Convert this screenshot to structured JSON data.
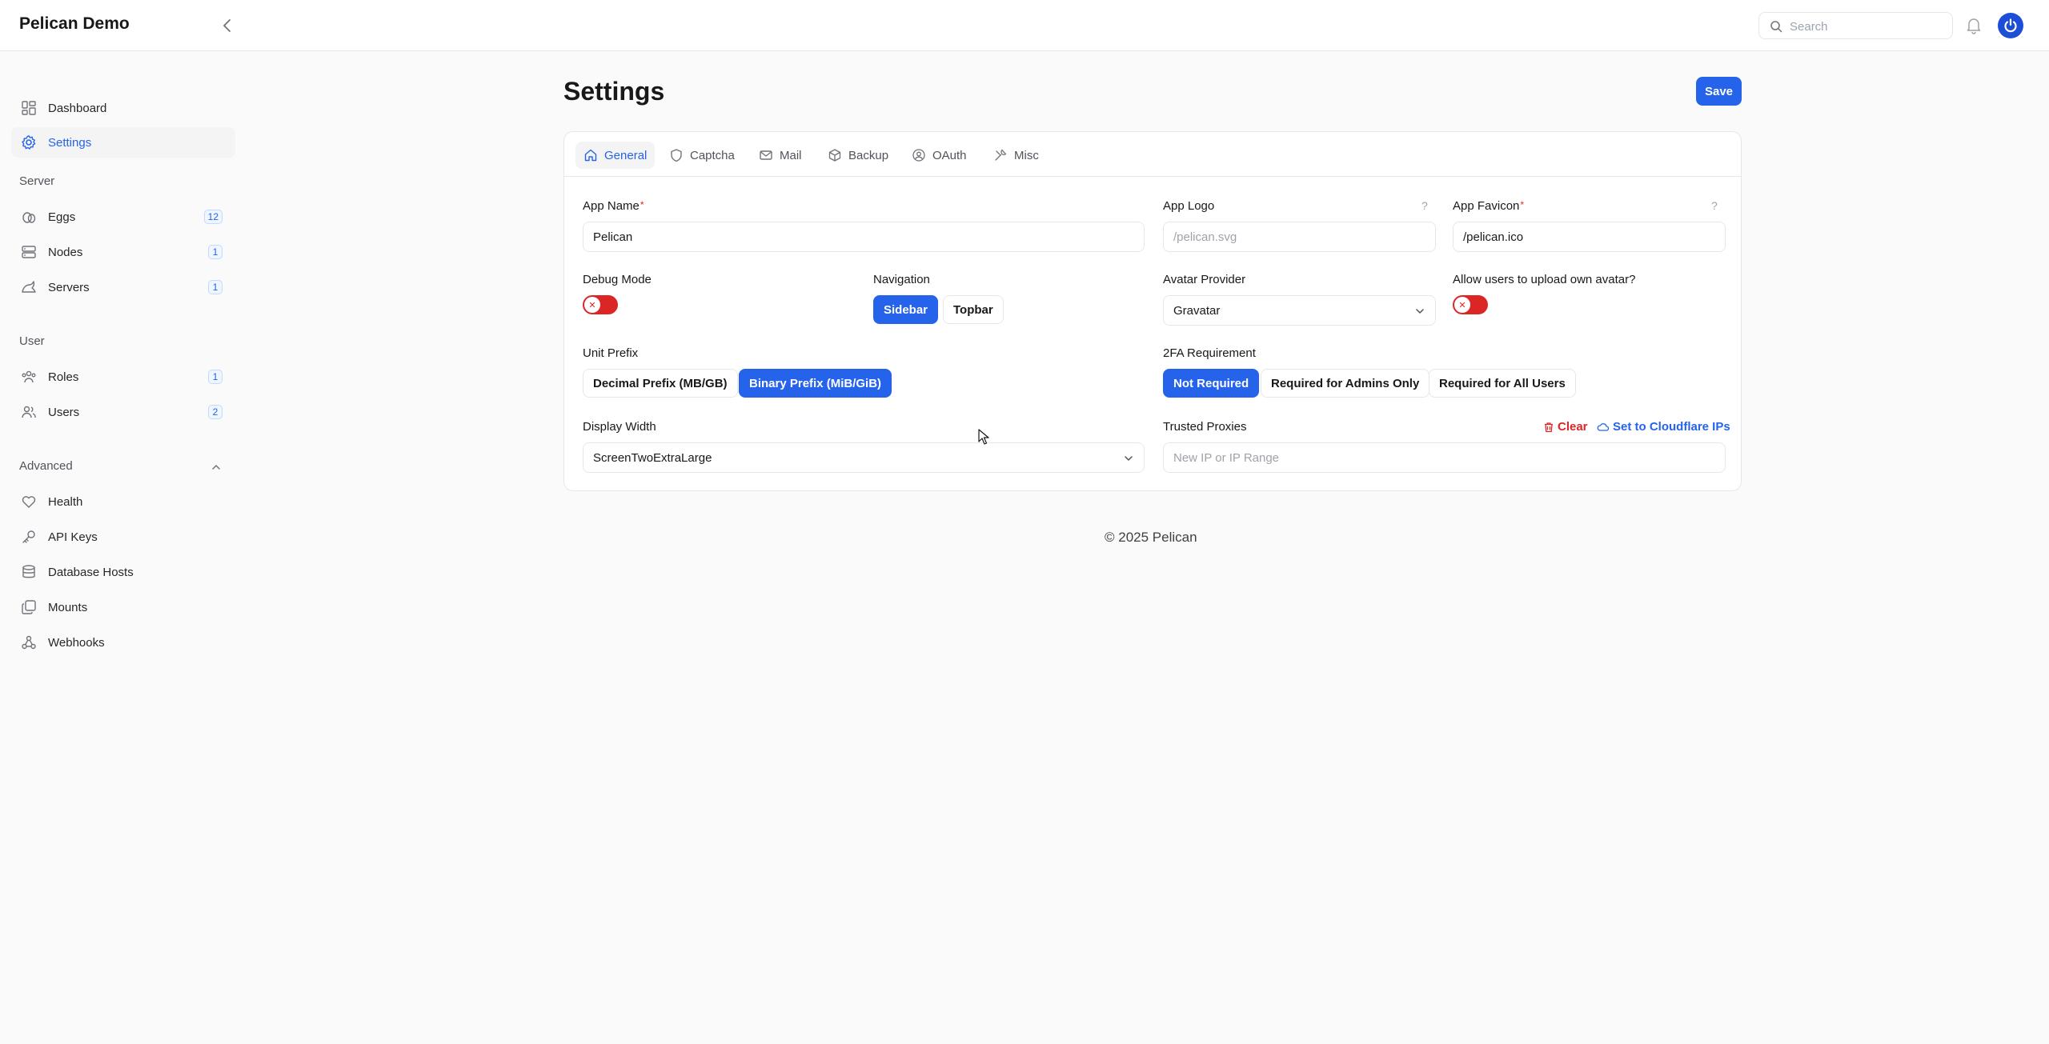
{
  "app": {
    "title": "Pelican Demo"
  },
  "search": {
    "placeholder": "Search"
  },
  "sidebar": {
    "top_items": [
      {
        "label": "Dashboard",
        "icon": "dashboard-icon"
      },
      {
        "label": "Settings",
        "icon": "gear-icon",
        "active": true
      }
    ],
    "groups": [
      {
        "title": "Server",
        "items": [
          {
            "label": "Eggs",
            "badge": "12",
            "icon": "egg-icon"
          },
          {
            "label": "Nodes",
            "badge": "1",
            "icon": "server-stack-icon"
          },
          {
            "label": "Servers",
            "badge": "1",
            "icon": "brand-icon"
          }
        ]
      },
      {
        "title": "User",
        "items": [
          {
            "label": "Roles",
            "badge": "1",
            "icon": "users-group-icon"
          },
          {
            "label": "Users",
            "badge": "2",
            "icon": "users-icon"
          }
        ]
      },
      {
        "title": "Advanced",
        "items": [
          {
            "label": "Health",
            "icon": "heart-icon"
          },
          {
            "label": "API Keys",
            "icon": "key-icon"
          },
          {
            "label": "Database Hosts",
            "icon": "database-icon"
          },
          {
            "label": "Mounts",
            "icon": "layers-icon"
          },
          {
            "label": "Webhooks",
            "icon": "webhook-icon"
          }
        ]
      }
    ]
  },
  "page": {
    "title": "Settings",
    "save_label": "Save"
  },
  "tabs": [
    {
      "label": "General",
      "icon": "home-icon",
      "active": true
    },
    {
      "label": "Captcha",
      "icon": "shield-icon"
    },
    {
      "label": "Mail",
      "icon": "mail-icon"
    },
    {
      "label": "Backup",
      "icon": "box-icon"
    },
    {
      "label": "OAuth",
      "icon": "user-circle-icon"
    },
    {
      "label": "Misc",
      "icon": "tools-icon"
    }
  ],
  "form": {
    "app_name": {
      "label": "App Name",
      "value": "Pelican"
    },
    "app_logo": {
      "label": "App Logo",
      "placeholder": "/pelican.svg"
    },
    "app_favicon": {
      "label": "App Favicon",
      "value": "/pelican.ico"
    },
    "debug_mode": {
      "label": "Debug Mode",
      "enabled": false
    },
    "navigation": {
      "label": "Navigation",
      "options": [
        "Sidebar",
        "Topbar"
      ],
      "selected": "Sidebar"
    },
    "avatar_provider": {
      "label": "Avatar Provider",
      "value": "Gravatar"
    },
    "allow_avatar_upload": {
      "label": "Allow users to upload own avatar?",
      "enabled": false
    },
    "unit_prefix": {
      "label": "Unit Prefix",
      "options": [
        "Decimal Prefix (MB/GB)",
        "Binary Prefix (MiB/GiB)"
      ],
      "selected": "Binary Prefix (MiB/GiB)"
    },
    "twofa": {
      "label": "2FA Requirement",
      "options": [
        "Not Required",
        "Required for Admins Only",
        "Required for All Users"
      ],
      "selected": "Not Required"
    },
    "display_width": {
      "label": "Display Width",
      "value": "ScreenTwoExtraLarge"
    },
    "trusted_proxies": {
      "label": "Trusted Proxies",
      "placeholder": "New IP or IP Range",
      "clear_label": "Clear",
      "cloudflare_label": "Set to Cloudflare IPs"
    },
    "help_mark": "?",
    "required_mark": "*"
  },
  "footer": {
    "text": "© 2025 Pelican"
  },
  "colors": {
    "primary": "#2563eb",
    "danger": "#dc2626"
  }
}
